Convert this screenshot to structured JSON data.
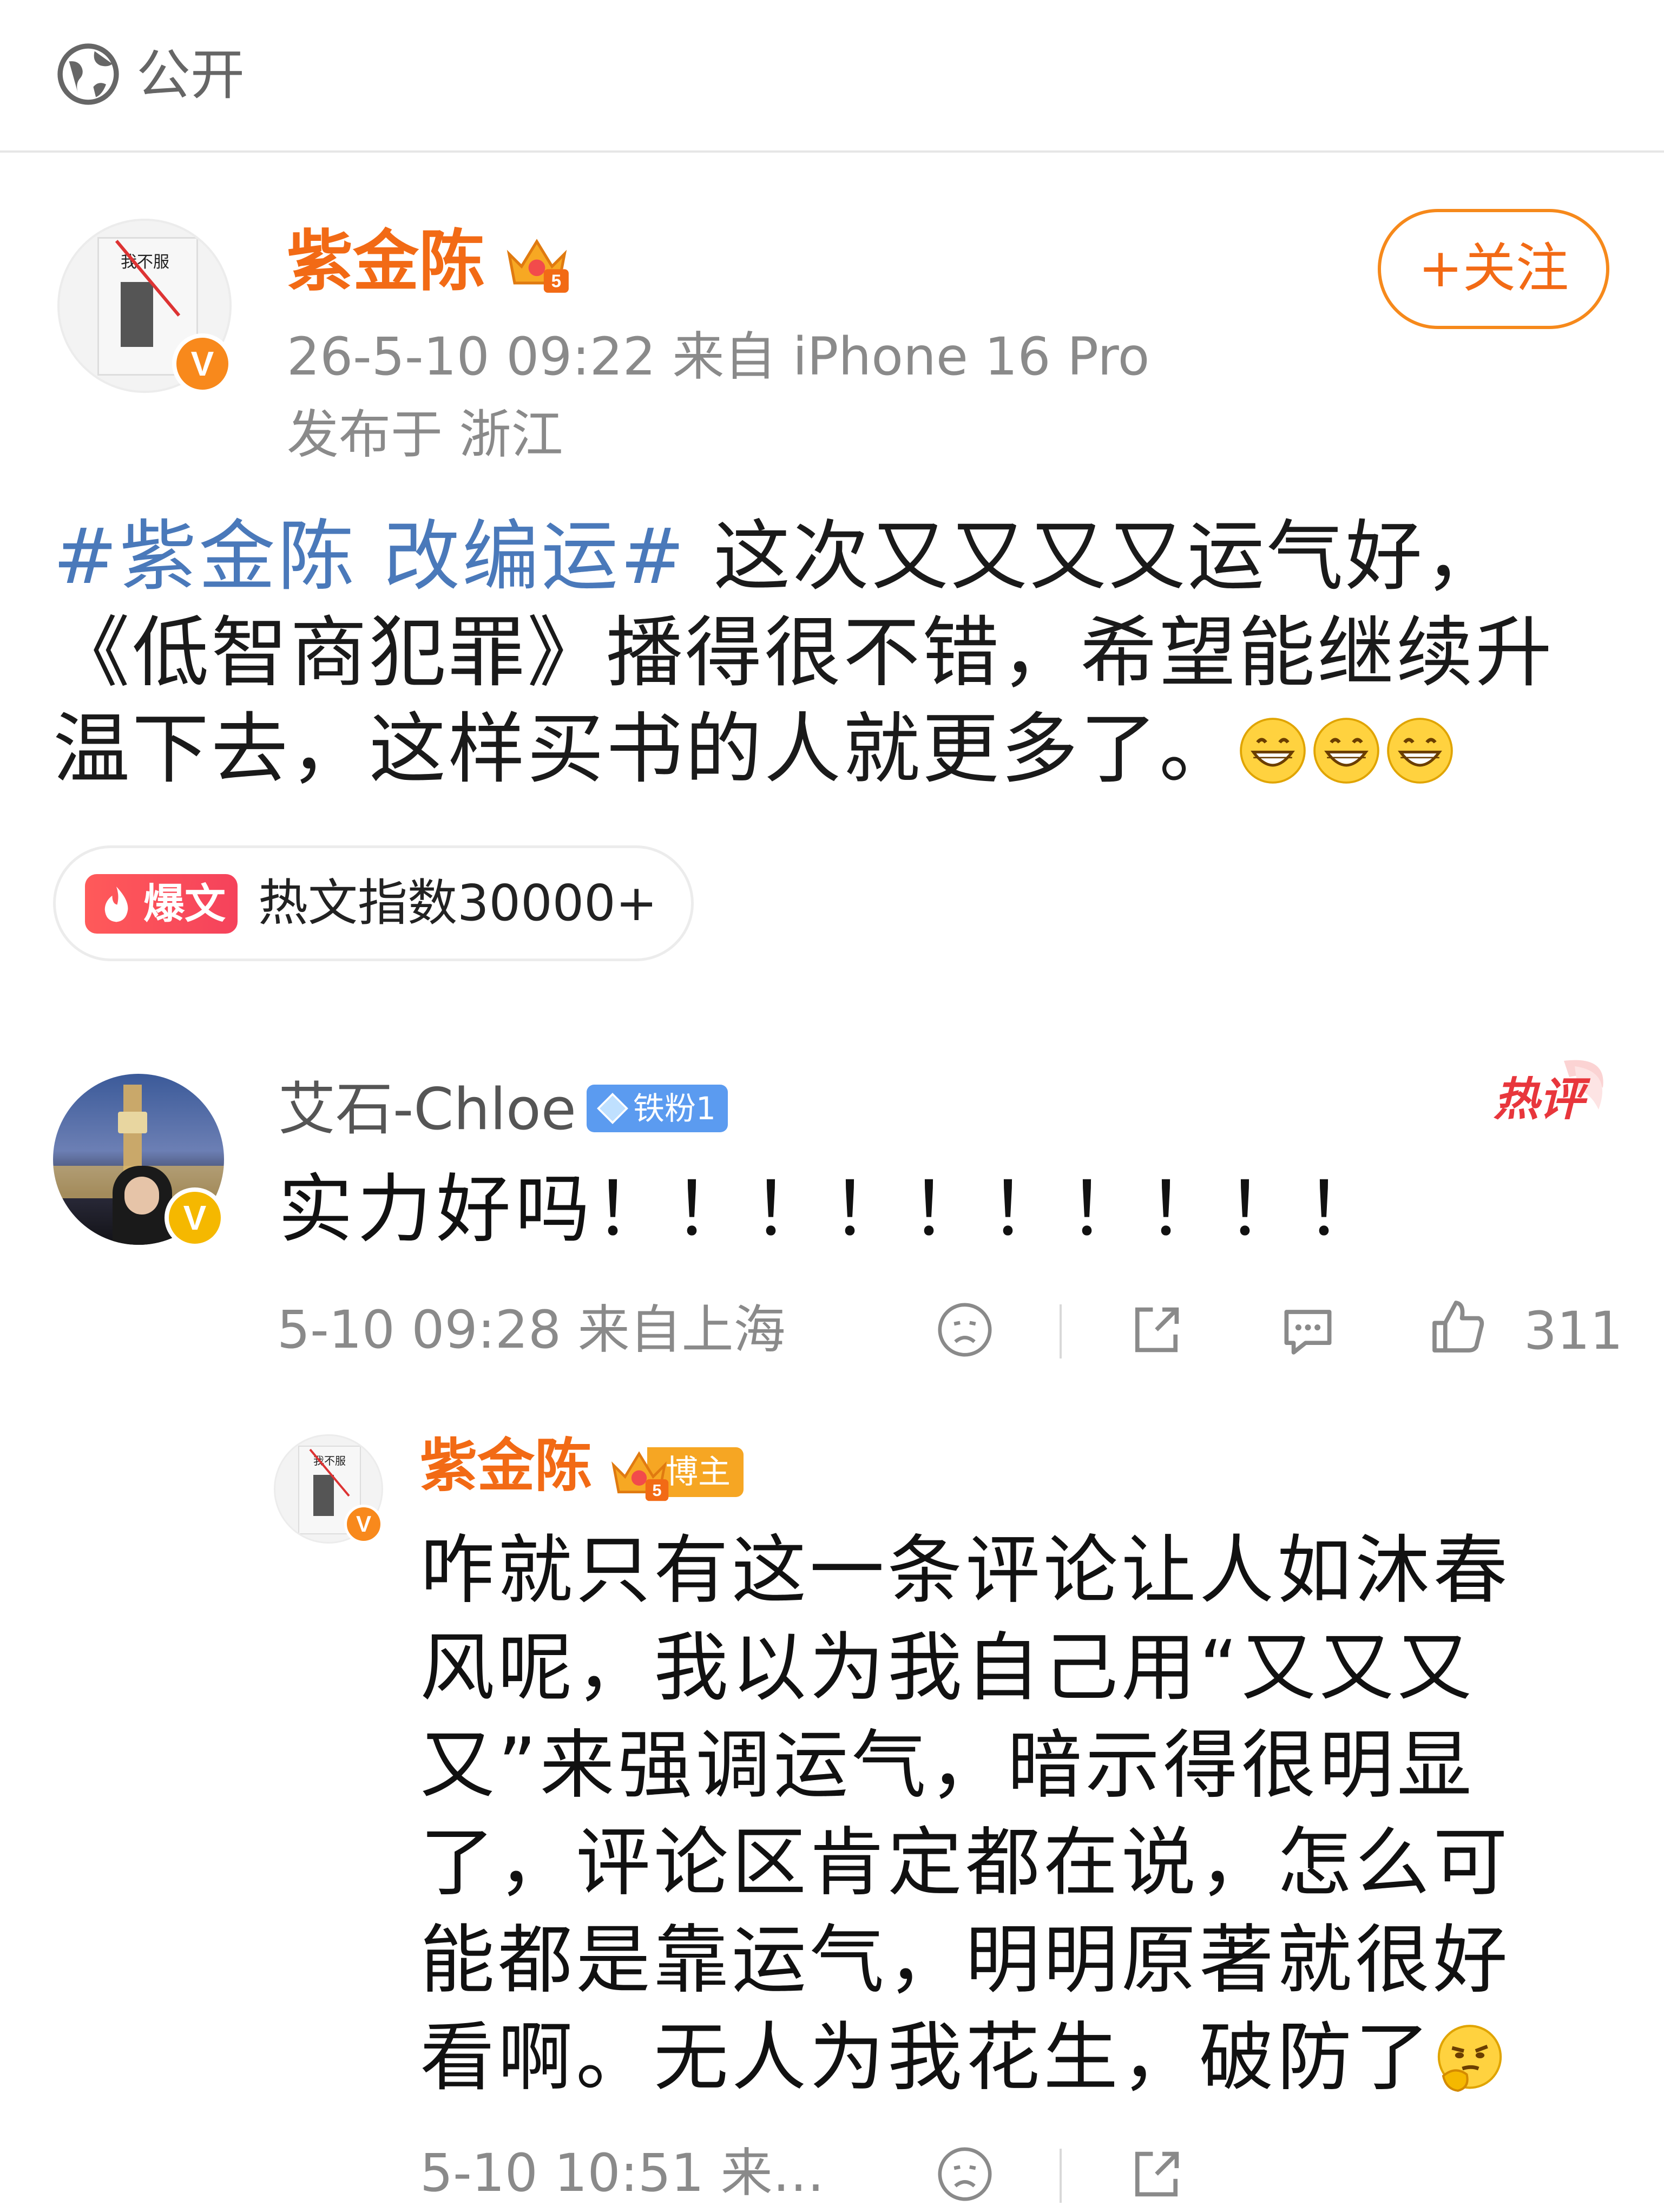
{
  "visibility": {
    "label": "公开",
    "icon": "globe-icon"
  },
  "post": {
    "author": "紫金陈",
    "meta": "26-5-10 09:22  来自 iPhone 16 Pro",
    "location": "发布于 浙江",
    "follow_label": "+关注",
    "topic": "#紫金陈 改编运#",
    "body": " 这次又又又又运气好，《低智商犯罪》播得很不错，希望能继续升温下去，这样买书的人就更多了。",
    "emoji": "grin-emoji",
    "avatar_book_title": "我不服"
  },
  "hot_tag": {
    "badge": "爆文",
    "text": "热文指数30000+"
  },
  "comment": {
    "author": "艾石-Chloe",
    "fan_badge": "铁粉1",
    "hot_label": "热评",
    "text": "实力好吗！！！！！！！！！！",
    "meta": "5-10 09:28 来自上海",
    "likes": "311"
  },
  "reply": {
    "author": "紫金陈",
    "role_badge": "博主",
    "text": "咋就只有这一条评论让人如沐春风呢，我以为我自己用“又又又又”来强调运气，暗示得很明显了，评论区肯定都在说，怎么可能都是靠运气，明明原著就很好看啊。无人为我花生，破防了",
    "emoji": "thinking-emoji",
    "meta": "5-10 10:51 来…"
  },
  "colors": {
    "brand_orange": "#f26a15",
    "topic_blue": "#4a79ba",
    "meta_gray": "#8a8a8a",
    "hot_red": "#f5425b"
  }
}
